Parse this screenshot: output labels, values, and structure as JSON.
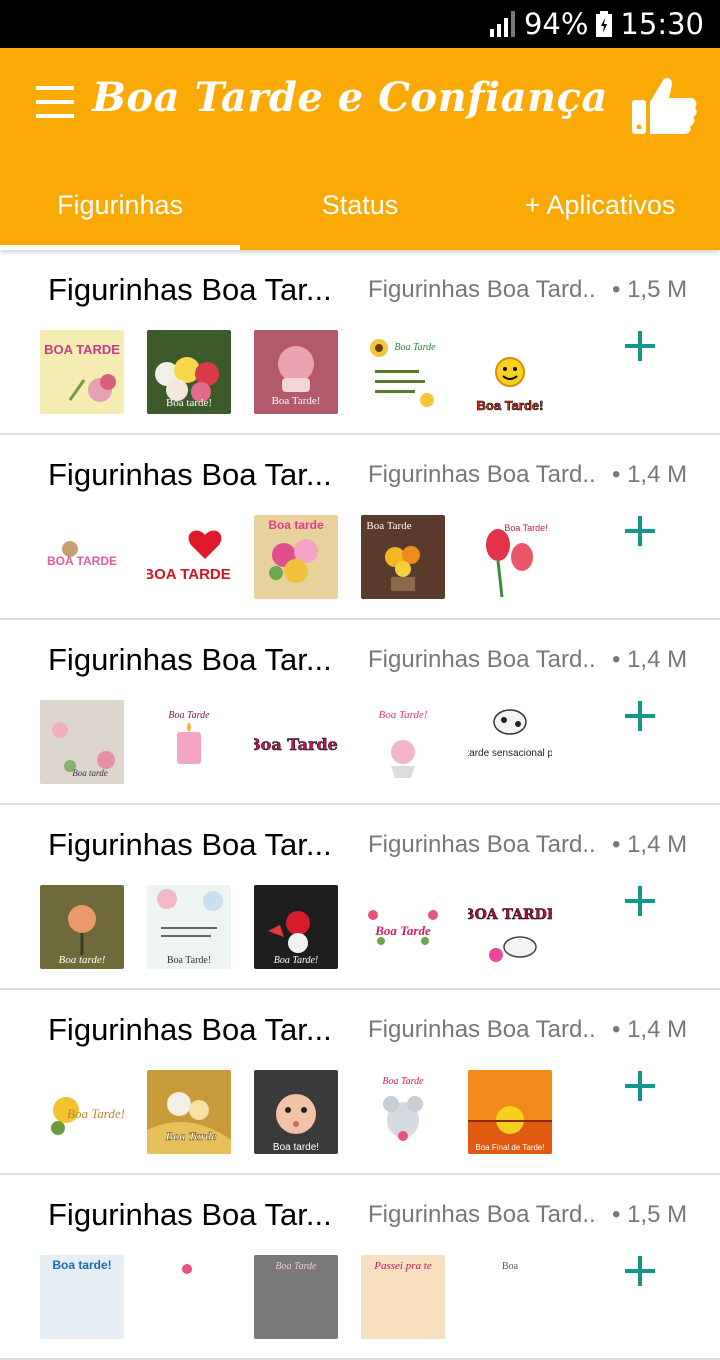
{
  "status_bar": {
    "battery": "94%",
    "time": "15:30"
  },
  "app_bar": {
    "title": "Boa Tarde e Confiança"
  },
  "tabs": [
    {
      "label": "Figurinhas"
    },
    {
      "label": "Status"
    },
    {
      "label": "+ Aplicativos"
    }
  ],
  "colors": {
    "accent": "#fbaa05",
    "add_icon": "#13978c"
  },
  "packs": [
    {
      "name": "Figurinhas Boa Tar...",
      "publisher": "Figurinhas Boa Tard...",
      "size": "• 1,5 M",
      "stickers": [
        "BOA TARDE",
        "Boa tarde!",
        "Boa Tarde!",
        "Boa Tarde",
        "Boa Tarde!"
      ]
    },
    {
      "name": "Figurinhas Boa Tar...",
      "publisher": "Figurinhas Boa Tard...",
      "size": "• 1,4 M",
      "stickers": [
        "BOA TARDE",
        "BOA TARDE",
        "Boa tarde",
        "Boa Tarde",
        "Boa Tarde!"
      ]
    },
    {
      "name": "Figurinhas Boa Tar...",
      "publisher": "Figurinhas Boa Tard...",
      "size": "• 1,4 M",
      "stickers": [
        "Boa tarde",
        "Boa Tarde",
        "Boa Tarde!",
        "Boa Tarde!",
        "Uma tarde sensacional pra vc!"
      ]
    },
    {
      "name": "Figurinhas Boa Tar...",
      "publisher": "Figurinhas Boa Tard...",
      "size": "• 1,4 M",
      "stickers": [
        "Boa tarde!",
        "Boa Tarde!",
        "Boa Tarde!",
        "Boa Tarde",
        "BOA TARDE"
      ]
    },
    {
      "name": "Figurinhas Boa Tar...",
      "publisher": "Figurinhas Boa Tard...",
      "size": "• 1,4 M",
      "stickers": [
        "Boa Tarde!",
        "Boa Tarde",
        "Boa tarde!",
        "Boa Tarde",
        "Boa Final de Tarde!"
      ]
    },
    {
      "name": "Figurinhas Boa Tar...",
      "publisher": "Figurinhas Boa Tard...",
      "size": "• 1,5 M",
      "stickers": [
        "Boa tarde!",
        "",
        "Boa Tarde",
        "Passei pra te",
        "Boa"
      ]
    }
  ]
}
